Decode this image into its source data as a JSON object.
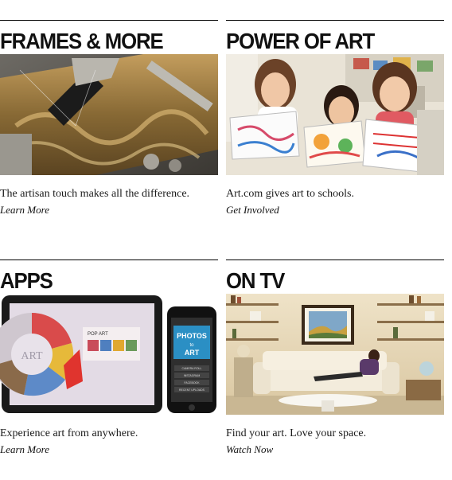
{
  "cards": [
    {
      "title": "FRAMES & MORE",
      "description": "The artisan touch makes all the difference.",
      "link": "Learn More",
      "image": "artisan-framing-photo"
    },
    {
      "title": "POWER OF ART",
      "description": "Art.com gives art to schools.",
      "link": "Get Involved",
      "image": "school-children-art-photo"
    },
    {
      "title": "APPS",
      "description": "Experience art from anywhere.",
      "link": "Learn More",
      "image": "tablet-phone-apps-photo",
      "image_text": {
        "tablet_wheel": "ART",
        "tablet_panel": "POP ART",
        "phone_logo_top": "PHOTOS",
        "phone_logo_mid": "to",
        "phone_logo_bottom": "ART",
        "phone_menu": [
          "CAMERA ROLL",
          "INSTAGRAM",
          "FACEBOOK",
          "RECENT UPLOADS"
        ]
      }
    },
    {
      "title": "ON TV",
      "description": "Find your art. Love your space.",
      "link": "Watch Now",
      "image": "living-room-tv-ad-photo"
    }
  ]
}
